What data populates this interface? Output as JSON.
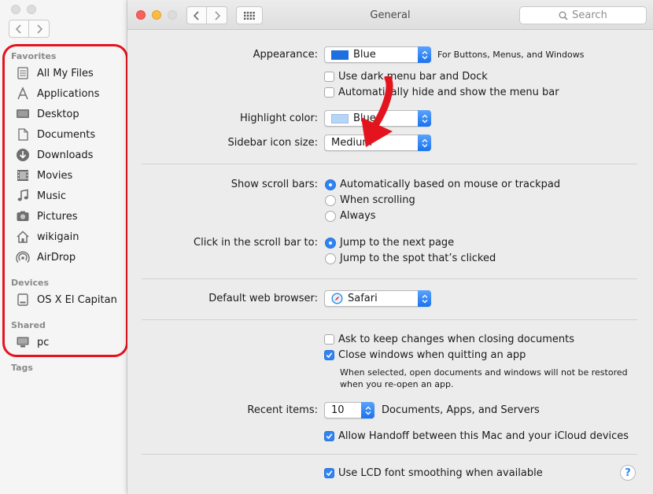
{
  "sidebar": {
    "sections": {
      "favorites": "Favorites",
      "devices": "Devices",
      "shared": "Shared",
      "tags": "Tags"
    },
    "favorites": [
      {
        "label": "All My Files",
        "icon": "all-files-icon"
      },
      {
        "label": "Applications",
        "icon": "applications-icon"
      },
      {
        "label": "Desktop",
        "icon": "desktop-icon"
      },
      {
        "label": "Documents",
        "icon": "documents-icon"
      },
      {
        "label": "Downloads",
        "icon": "downloads-icon"
      },
      {
        "label": "Movies",
        "icon": "movies-icon"
      },
      {
        "label": "Music",
        "icon": "music-icon"
      },
      {
        "label": "Pictures",
        "icon": "pictures-icon"
      },
      {
        "label": "wikigain",
        "icon": "home-icon"
      },
      {
        "label": "AirDrop",
        "icon": "airdrop-icon"
      }
    ],
    "devices": [
      {
        "label": "OS X El Capitan",
        "icon": "disk-icon"
      }
    ],
    "shared": [
      {
        "label": "pc",
        "icon": "computer-icon"
      }
    ]
  },
  "window": {
    "title": "General",
    "search_placeholder": "Search"
  },
  "appearance": {
    "label": "Appearance:",
    "value": "Blue",
    "hint": "For Buttons, Menus, and Windows",
    "swatch_color": "#1e6fe0",
    "dark_menu": "Use dark menu bar and Dock",
    "auto_hide": "Automatically hide and show the menu bar"
  },
  "highlight": {
    "label": "Highlight color:",
    "value": "Blue",
    "swatch_color": "#b7d5f7"
  },
  "sidebar_icon_size": {
    "label": "Sidebar icon size:",
    "value": "Medium"
  },
  "scroll_bars": {
    "label": "Show scroll bars:",
    "options": [
      "Automatically based on mouse or trackpad",
      "When scrolling",
      "Always"
    ],
    "selected": 0
  },
  "click_scroll": {
    "label": "Click in the scroll bar to:",
    "options": [
      "Jump to the next page",
      "Jump to the spot that’s clicked"
    ],
    "selected": 0
  },
  "browser": {
    "label": "Default web browser:",
    "value": "Safari"
  },
  "documents": {
    "ask_keep": "Ask to keep changes when closing documents",
    "close_windows": "Close windows when quitting an app",
    "note_line1": "When selected, open documents and windows will not be restored",
    "note_line2": "when you re-open an app."
  },
  "recent": {
    "label": "Recent items:",
    "value": "10",
    "suffix": "Documents, Apps, and Servers"
  },
  "handoff": "Allow Handoff between this Mac and your iCloud devices",
  "lcd": "Use LCD font smoothing when available",
  "help_label": "?",
  "colors": {
    "accent": "#2f83f3",
    "annotation": "#e3141e"
  }
}
